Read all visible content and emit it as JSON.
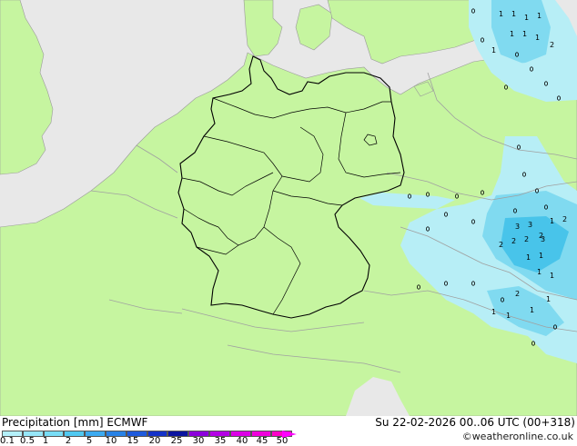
{
  "map": {
    "colors": {
      "sea": "#e8e8e8",
      "land": "#c6f5a0",
      "border": "#000000",
      "border_foreign": "#a0a0a0",
      "precip_light": "#b7eef6",
      "precip_mid": "#80daf0",
      "precip_strong": "#48c4ea"
    },
    "precip_numbers": [
      "1",
      "1",
      "1",
      "1",
      "1",
      "1",
      "1",
      "1",
      "2",
      "2",
      "2",
      "2",
      "2",
      "3",
      "3",
      "3",
      "1",
      "2",
      "1",
      "1",
      "1",
      "1",
      "2",
      "1",
      "1",
      "1",
      "1"
    ]
  },
  "footer": {
    "title": "Precipitation [mm]  ECMWF",
    "datetime": "Su 22-02-2026 00..06 UTC (00+318)",
    "credit": "©weatheronline.co.uk",
    "colorbar_colors": [
      "#b4f0fa",
      "#96e6f8",
      "#78dcf5",
      "#50c8f0",
      "#3caaf0",
      "#2882e6",
      "#1e5adc",
      "#1432c8",
      "#0a14a0",
      "#8c00dc",
      "#b400e6",
      "#dc00e6",
      "#f000dc",
      "#ff00c8"
    ],
    "colorbar_labels": [
      "0.1",
      "0.5",
      "1",
      "2",
      "5",
      "10",
      "15",
      "20",
      "25",
      "30",
      "35",
      "40",
      "45",
      "50"
    ]
  }
}
